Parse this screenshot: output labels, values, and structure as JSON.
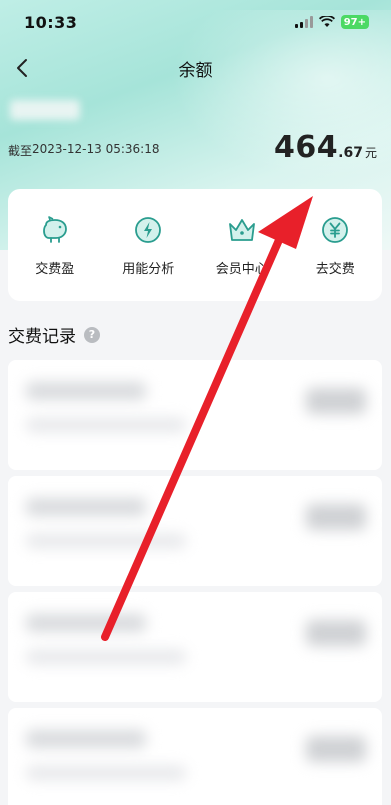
{
  "status_bar": {
    "time": "10:33",
    "battery": "97+"
  },
  "nav": {
    "title": "余额"
  },
  "balance": {
    "as_of_label": "截至",
    "as_of_time": "2023-12-13 05:36:18",
    "integer": "464",
    "decimal": ".67",
    "unit": "元"
  },
  "services": [
    {
      "label": "交费盈",
      "icon": "piggy-bank-icon"
    },
    {
      "label": "用能分析",
      "icon": "lightning-icon"
    },
    {
      "label": "会员中心",
      "icon": "crown-icon"
    },
    {
      "label": "去交费",
      "icon": "yuan-icon"
    }
  ],
  "records": {
    "title": "交费记录",
    "help": "?"
  },
  "colors": {
    "accent": "#2a9d8f",
    "hero": "#a6e4d9",
    "annotation_arrow": "#e8202a"
  }
}
